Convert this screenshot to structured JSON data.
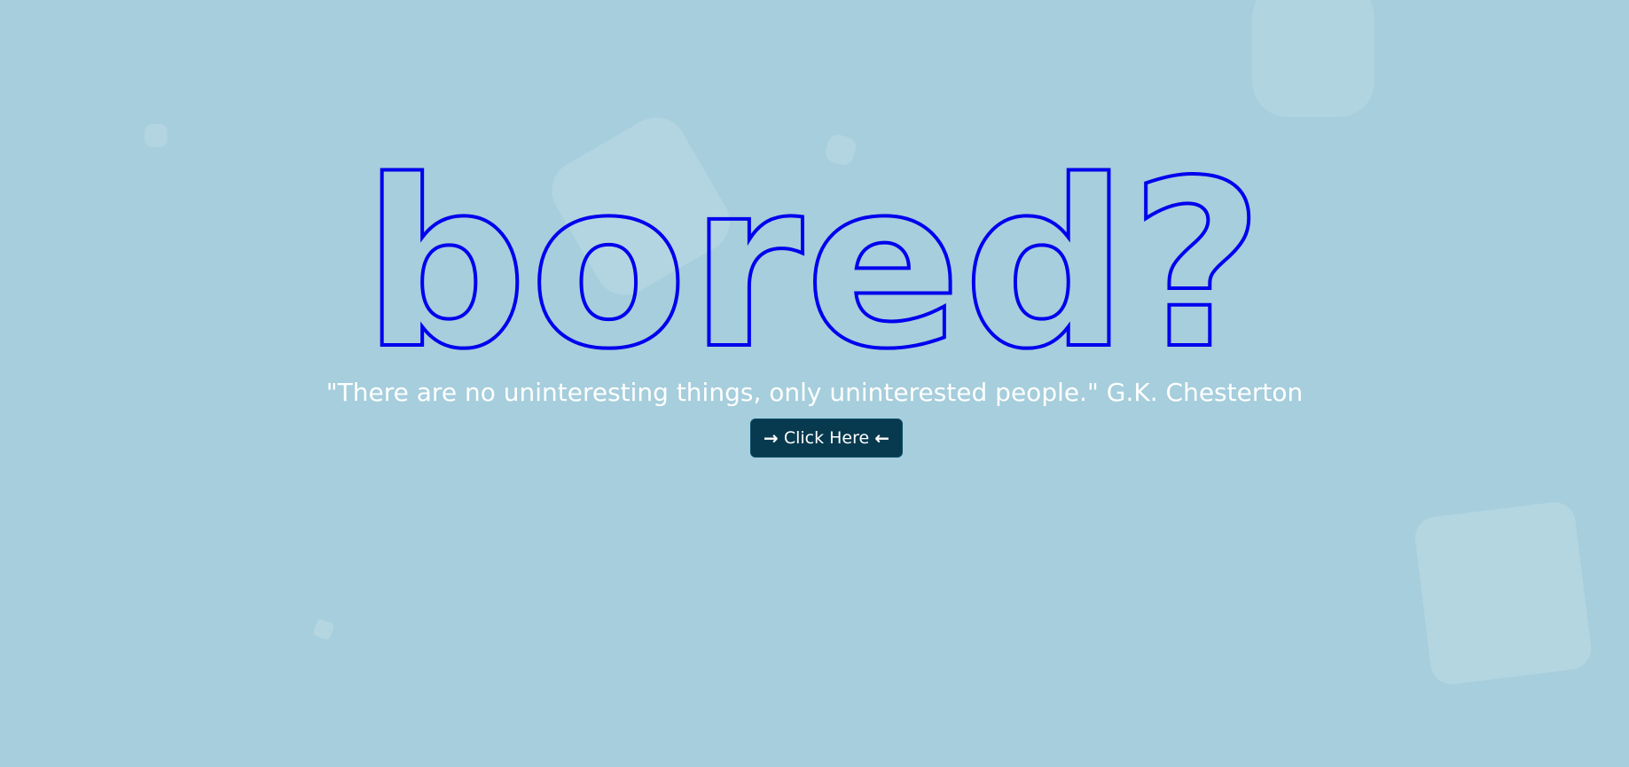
{
  "hero": {
    "headline": "bored?",
    "headline_color": "#0000ee",
    "quote": "\"There are no uninteresting things, only uninterested people.\" G.K. Chesterton"
  },
  "cta": {
    "label": "Click Here",
    "left_icon": "arrow-right-icon",
    "right_icon": "arrow-left-icon",
    "background": "#083a4f"
  },
  "theme": {
    "background": "#a6cedc",
    "text_color": "#ffffff"
  }
}
